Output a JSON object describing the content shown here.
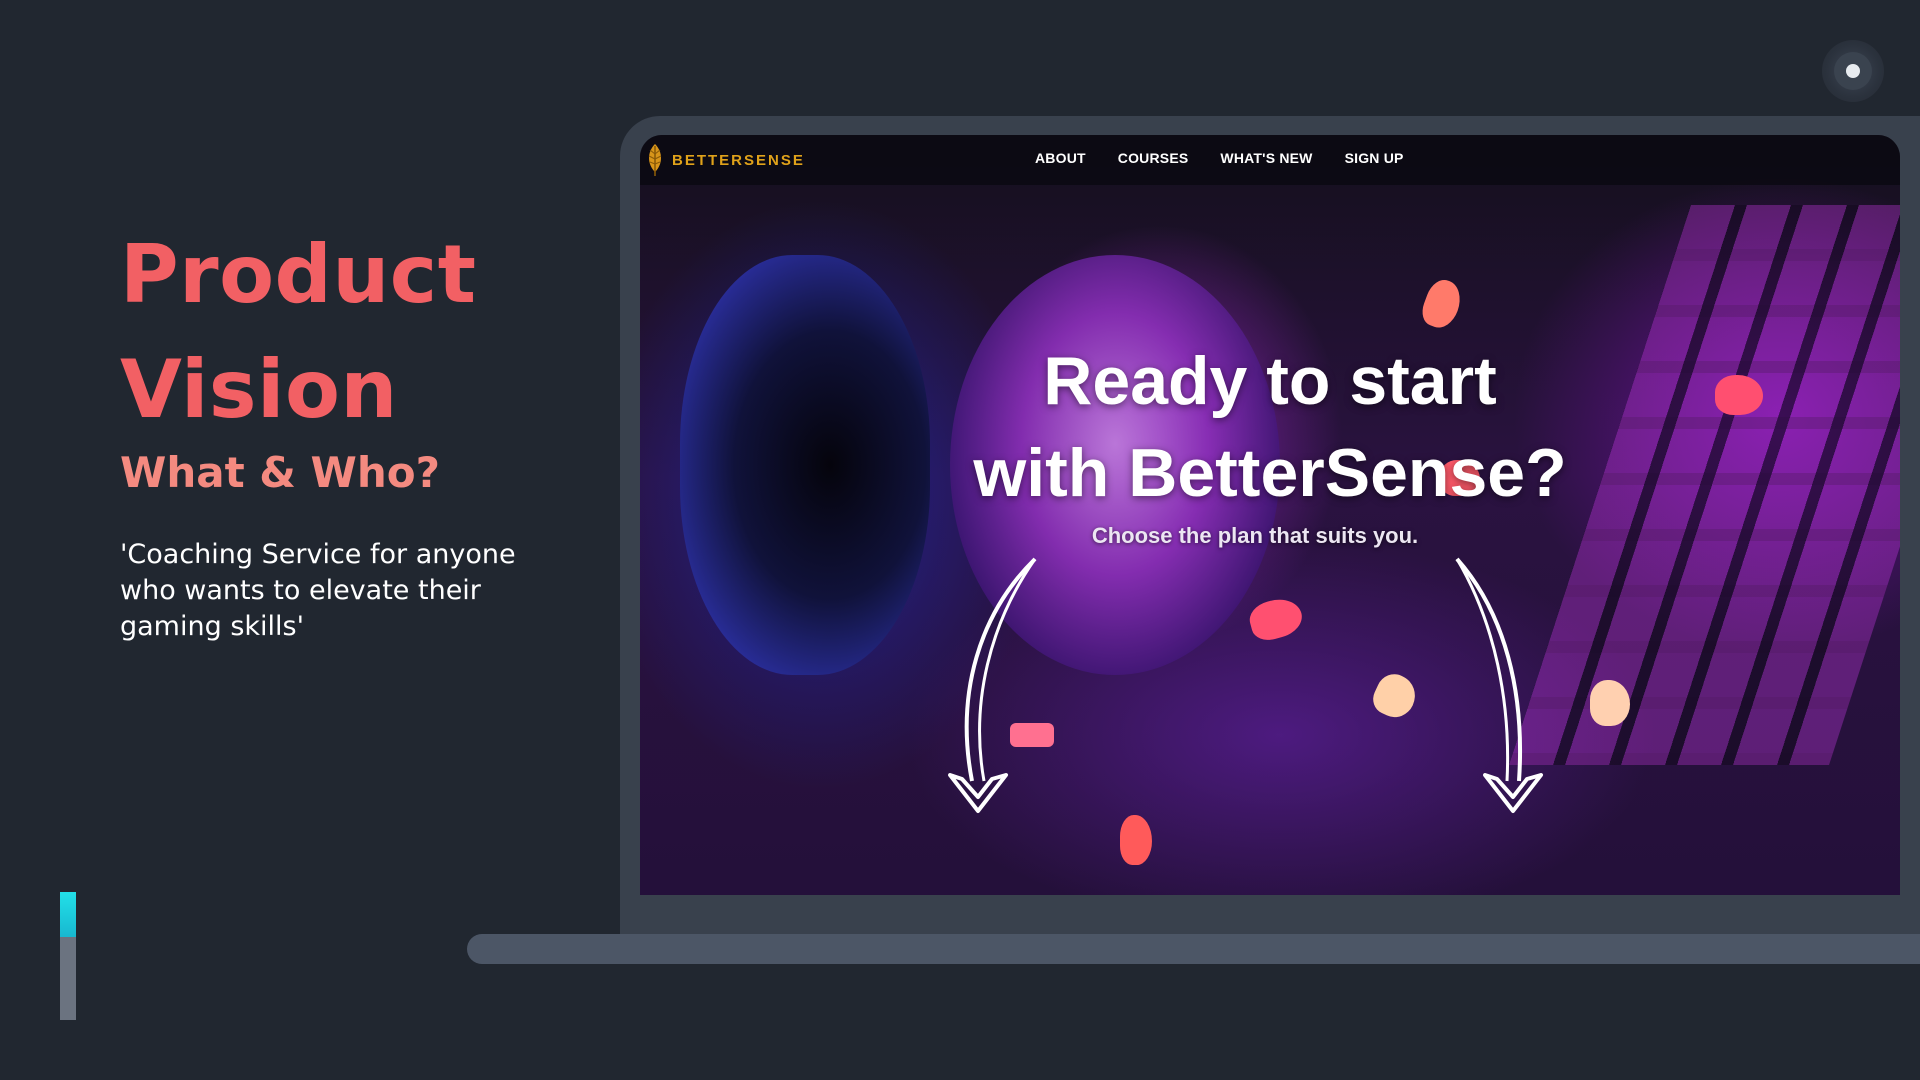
{
  "slide": {
    "title_line_1": "Product",
    "title_line_2": "Vision",
    "subtitle": "What & Who?",
    "description": "'Coaching Service for anyone who wants to elevate their gaming skills'",
    "progress_fraction": 0.35
  },
  "website": {
    "brand": "BETTERSENSE",
    "nav": [
      "ABOUT",
      "COURSES",
      "WHAT'S NEW",
      "SIGN UP"
    ],
    "hero_line_1": "Ready to start",
    "hero_line_2": "with BetterSense?",
    "hero_subtitle": "Choose the plan that suits you."
  },
  "colors": {
    "background": "#212730",
    "title": "#f26064",
    "subtitle": "#f48a80",
    "progress_accent": "#22e0e8",
    "brand": "#e0a21a"
  },
  "icons": [
    "record-icon",
    "leaf-logo-icon",
    "arrow-down-icon"
  ]
}
